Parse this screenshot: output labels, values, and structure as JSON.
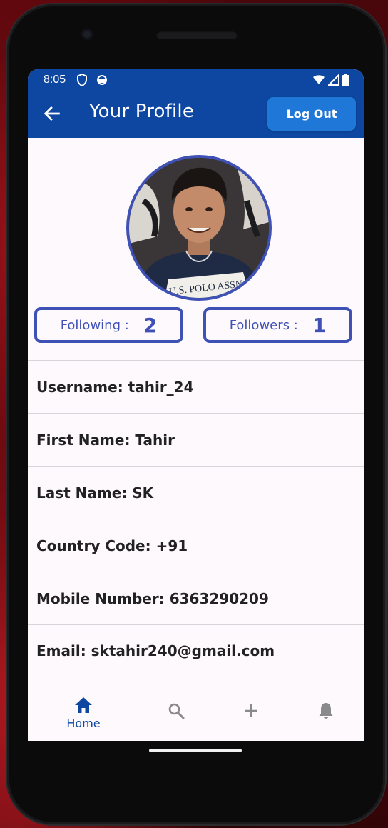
{
  "status_bar": {
    "time": "8:05"
  },
  "app_bar": {
    "title": "Your Profile",
    "logout_label": "Log Out"
  },
  "stats": {
    "following_label": "Following :",
    "following_count": "2",
    "followers_label": "Followers :",
    "followers_count": "1"
  },
  "profile": {
    "username": "Username: tahir_24",
    "first_name": "First Name: Tahir",
    "last_name": "Last Name: SK",
    "country_code": "Country Code: +91",
    "mobile": "Mobile Number: 6363290209",
    "email": "Email: sktahir240@gmail.com"
  },
  "avatar": {
    "shirt_text": "U.S. POLO ASSN"
  },
  "bottom_nav": {
    "home_label": "Home",
    "items": [
      "home-icon",
      "search-icon",
      "add-icon",
      "bell-icon"
    ]
  },
  "colors": {
    "primary": "#0d47a1",
    "accent": "#3f51b5",
    "button": "#1f77d8",
    "background": "#fdf9fd"
  }
}
